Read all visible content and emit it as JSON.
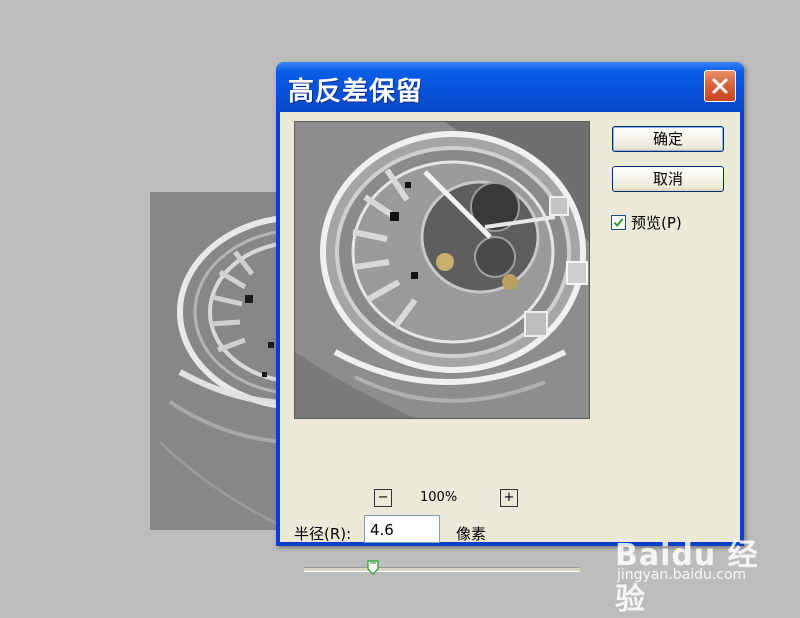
{
  "dialog": {
    "title": "高反差保留",
    "ok_label": "确定",
    "cancel_label": "取消",
    "preview_label": "预览(P)",
    "preview_checked": true,
    "zoom_minus": "−",
    "zoom_plus": "+",
    "zoom_level": "100%",
    "radius_label": "半径(R):",
    "radius_value": "4.6",
    "radius_unit": "像素",
    "slider_level": 0.25
  },
  "watermark": {
    "logo": "Baidu 经验",
    "url": "jingyan.baidu.com"
  },
  "colors": {
    "titlebar": "#0852db",
    "client": "#ece9d8",
    "close": "#d45a30",
    "check": "#21a121"
  }
}
